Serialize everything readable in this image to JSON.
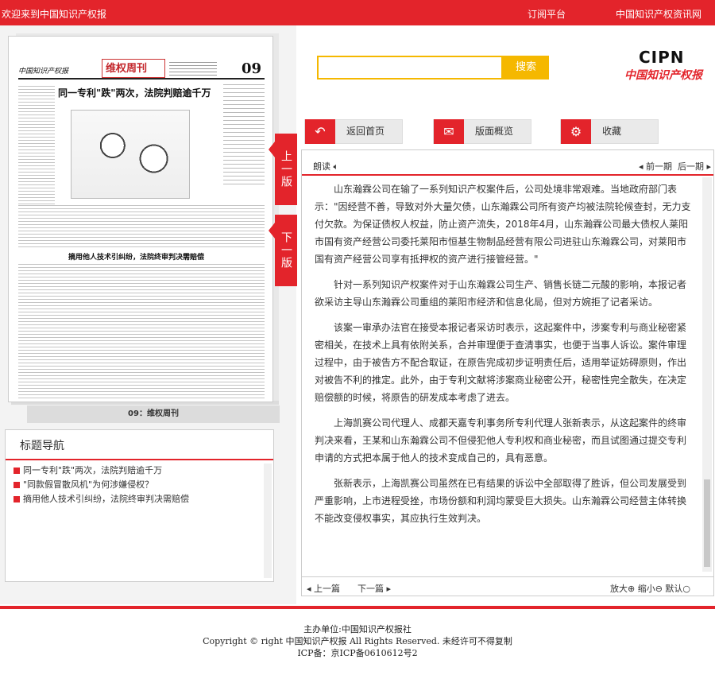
{
  "topbar": {
    "welcome": "欢迎来到中国知识产权报",
    "links": [
      "订阅平台",
      "中国知识产权资讯网"
    ]
  },
  "paper": {
    "masthead_left": "中国知识产权报",
    "section_title": "维权周刊",
    "page_number": "09",
    "headline1": "同一专利\"跌\"两次，法院判赔逾千万",
    "headline2": "摘用他人技术引纠纷，法院终审判决需赔偿",
    "caption": "09：维权周刊"
  },
  "page_tabs": {
    "prev": "上一版",
    "next": "下一版"
  },
  "nav": {
    "title": "标题导航",
    "items": [
      "同一专利\"跌\"两次，法院判赔逾千万",
      "\"同款假冒散风机\"为何涉嫌侵权？",
      "摘用他人技术引纠纷，法院终审判决需赔偿"
    ]
  },
  "search": {
    "button": "搜索",
    "placeholder": ""
  },
  "logo": {
    "mark": "CIPN",
    "text": "中国知识产权报"
  },
  "toolbar": {
    "home": "返回首页",
    "overview": "版面概览",
    "favorite": "收藏"
  },
  "article": {
    "read": "朗读",
    "prev_issue": "前一期",
    "next_issue": "后一期",
    "paragraphs": [
      "山东瀚霖公司在输了一系列知识产权案件后，公司处境非常艰难。当地政府部门表示：\"因经营不善，导致对外大量欠债，山东瀚霖公司所有资产均被法院轮候查封，无力支付欠款。为保证债权人权益，防止资产流失，2018年4月，山东瀚霖公司最大债权人莱阳市国有资产经营公司委托莱阳市恒基生物制品经营有限公司进驻山东瀚霖公司，对莱阳市国有资产经营公司享有抵押权的资产进行接管经营。\"",
      "针对一系列知识产权案件对于山东瀚霖公司生产、销售长链二元酸的影响，本报记者欲采访主导山东瀚霖公司重组的莱阳市经济和信息化局，但对方婉拒了记者采访。",
      "该案一审承办法官在接受本报记者采访时表示，这起案件中，涉案专利与商业秘密紧密相关，在技术上具有依附关系，合并审理便于查清事实，也便于当事人诉讼。案件审理过程中，由于被告方不配合取证，在原告完成初步证明责任后，适用举证妨碍原则，作出对被告不利的推定。此外，由于专利文献将涉案商业秘密公开，秘密性完全散失，在决定赔偿额的时候，将原告的研发成本考虑了进去。",
      "上海凯赛公司代理人、成都天嘉专利事务所专利代理人张新表示，从这起案件的终审判决来看，王某和山东瀚霖公司不但侵犯他人专利权和商业秘密，而且试图通过提交专利申请的方式把本属于他人的技术变成自己的，具有恶意。",
      "张新表示，上海凯赛公司虽然在已有结果的诉讼中全部取得了胜诉，但公司发展受到严重影响，上市进程受挫，市场份额和利润均蒙受巨大损失。山东瀚霖公司经营主体转换不能改变侵权事实，其应执行生效判决。"
    ],
    "prev_page": "上一篇",
    "next_page": "下一篇",
    "zoom": "放大⊕ 缩小⊖ 默认○"
  },
  "footer": {
    "line1": "主办单位:中国知识产权报社",
    "line2": "Copyright © right 中国知识产权报 All Rights Reserved. 未经许可不得复制",
    "line3": "ICP备：京ICP备0610612号2"
  },
  "colors": {
    "brand_red": "#e3242b",
    "search_yellow": "#f5b800"
  }
}
